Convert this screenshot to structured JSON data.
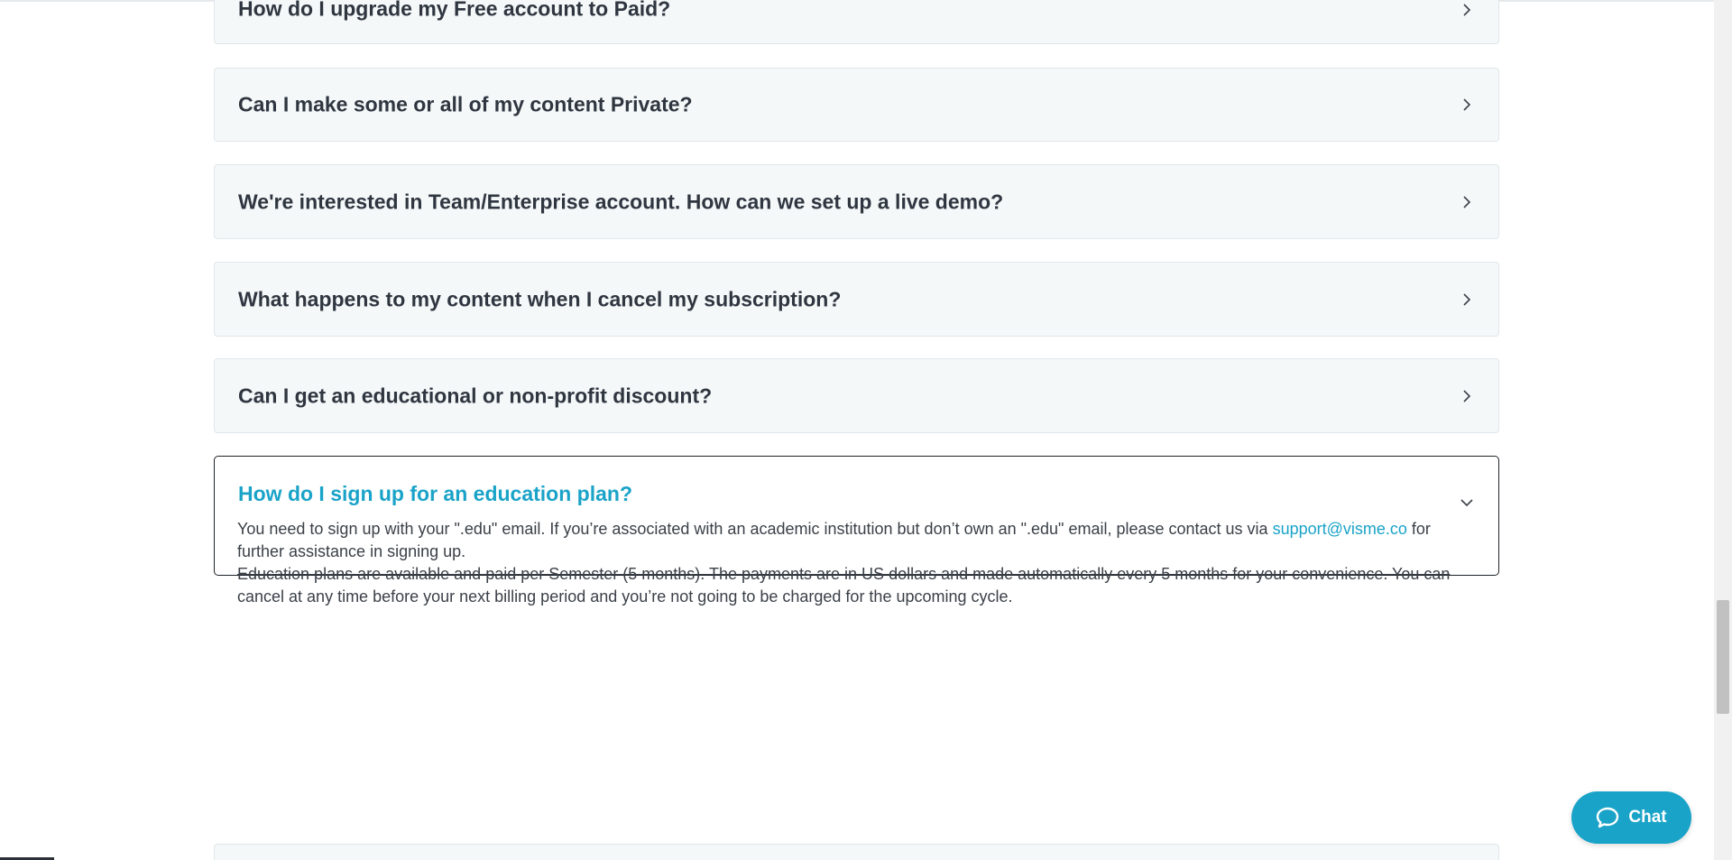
{
  "faq": {
    "items": [
      {
        "question": "How do I upgrade my Free account to Paid?"
      },
      {
        "question": "Can I make some or all of my content Private?"
      },
      {
        "question": "We're interested in Team/Enterprise account. How can we set up a live demo?"
      },
      {
        "question": "What happens to my content when I cancel my subscription?"
      },
      {
        "question": "Can I get an educational or non-profit discount?"
      }
    ],
    "open_item": {
      "question": "How do I sign up for an education plan?",
      "answer_part1": "You need to sign up with your \".edu\" email. If you’re associated with an academic institution but don’t own an \".edu\" email, please contact us via ",
      "answer_link": "support@visme.co",
      "answer_part2": " for further assistance in signing up.",
      "answer_line2_strike": "Education plans are available and paid per Semester (5 months). The payments are in US dollars and made automatically every 5 months for your convenience. You can",
      "answer_line3": "cancel at any time before your next billing period and you’re not going to be charged for the upcoming cycle."
    }
  },
  "chat": {
    "label": "Chat",
    "icon": "chat-bubble-icon"
  },
  "colors": {
    "accent": "#1aa3c8",
    "card_bg": "#f5f8f9",
    "text": "#2f3640"
  }
}
